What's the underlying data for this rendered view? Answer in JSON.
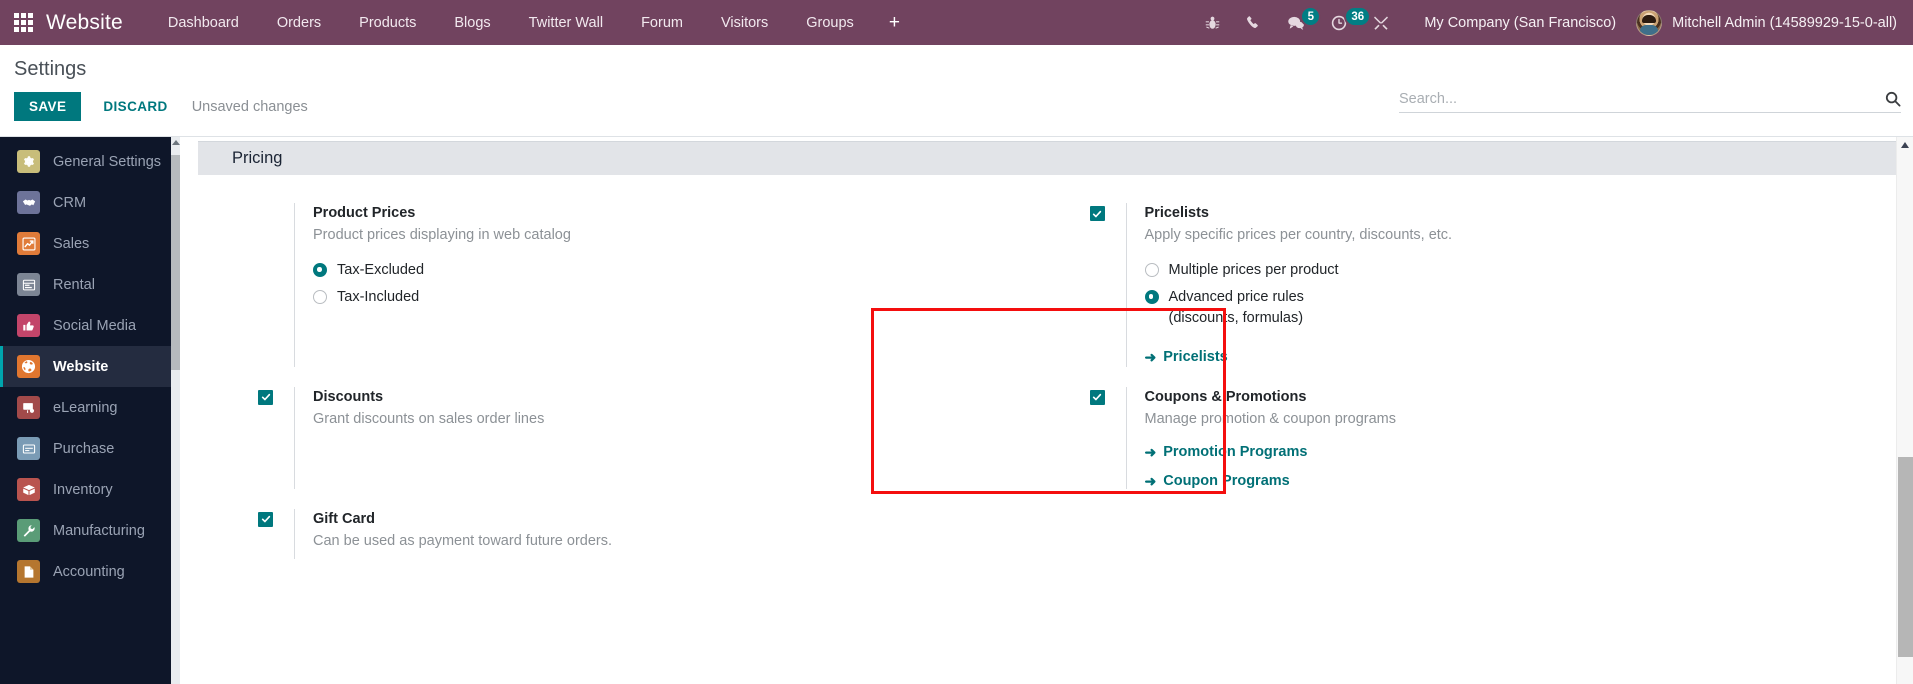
{
  "navbar": {
    "apps_icon": "apps-grid-icon",
    "brand": "Website",
    "menu_items": [
      {
        "label": "Dashboard"
      },
      {
        "label": "Orders"
      },
      {
        "label": "Products"
      },
      {
        "label": "Blogs"
      },
      {
        "label": "Twitter Wall"
      },
      {
        "label": "Forum"
      },
      {
        "label": "Visitors"
      },
      {
        "label": "Groups"
      }
    ],
    "add_label": "+",
    "systray": [
      {
        "name": "bug-icon",
        "badge": ""
      },
      {
        "name": "phone-icon",
        "badge": ""
      },
      {
        "name": "messages-icon",
        "badge": "5"
      },
      {
        "name": "activities-clock-icon",
        "badge": "36"
      },
      {
        "name": "tools-icon",
        "badge": ""
      }
    ],
    "company": "My Company (San Francisco)",
    "user": "Mitchell Admin (14589929-15-0-all)",
    "background_color": "#71435f"
  },
  "control_panel": {
    "title": "Settings",
    "save_label": "SAVE",
    "discard_label": "DISCARD",
    "status_text": "Unsaved changes",
    "accent_color": "#00787e"
  },
  "search": {
    "placeholder": "Search...",
    "value": "",
    "icon": "search-icon"
  },
  "sidebar": {
    "items": [
      {
        "label": "General Settings",
        "icon": "gear-icon",
        "color": "#c8bd7a",
        "active": false
      },
      {
        "label": "CRM",
        "icon": "handshake-icon",
        "color": "#6d7399",
        "active": false
      },
      {
        "label": "Sales",
        "icon": "chart-up-icon",
        "color": "#e07b39",
        "active": false
      },
      {
        "label": "Rental",
        "icon": "calendar-icon",
        "color": "#7c8594",
        "active": false
      },
      {
        "label": "Social Media",
        "icon": "thumbs-up-icon",
        "color": "#c3456a",
        "active": false
      },
      {
        "label": "Website",
        "icon": "globe-icon",
        "color": "#e0762f",
        "active": true
      },
      {
        "label": "eLearning",
        "icon": "presentation-icon",
        "color": "#a24a4a",
        "active": false
      },
      {
        "label": "Purchase",
        "icon": "card-icon",
        "color": "#7a9bb5",
        "active": false
      },
      {
        "label": "Inventory",
        "icon": "box-icon",
        "color": "#b9544f",
        "active": false
      },
      {
        "label": "Manufacturing",
        "icon": "wrench-icon",
        "color": "#5a9c77",
        "active": false
      },
      {
        "label": "Accounting",
        "icon": "document-icon",
        "color": "#b5762f",
        "active": false
      }
    ]
  },
  "settings": {
    "section_title": "Pricing",
    "blocks": [
      {
        "id": "product-prices",
        "control": "none",
        "label": "Product Prices",
        "help": "Product prices displaying in web catalog",
        "radios": [
          {
            "label": "Tax-Excluded",
            "selected": true
          },
          {
            "label": "Tax-Included",
            "selected": false
          }
        ],
        "links": []
      },
      {
        "id": "pricelists",
        "control": "checkbox",
        "checked": true,
        "label": "Pricelists",
        "help": "Apply specific prices per country, discounts, etc.",
        "radios": [
          {
            "label": "Multiple prices per product",
            "selected": false
          },
          {
            "label": "Advanced price rules (discounts, formulas)",
            "selected": true
          }
        ],
        "links": [
          {
            "label": "Pricelists"
          }
        ]
      },
      {
        "id": "discounts",
        "control": "checkbox",
        "checked": true,
        "label": "Discounts",
        "help": "Grant discounts on sales order lines",
        "radios": [],
        "links": []
      },
      {
        "id": "coupons-promotions",
        "control": "checkbox",
        "checked": true,
        "label": "Coupons & Promotions",
        "help": "Manage promotion & coupon programs",
        "radios": [],
        "links": [
          {
            "label": "Promotion Programs"
          },
          {
            "label": "Coupon Programs"
          }
        ]
      },
      {
        "id": "gift-card",
        "control": "checkbox",
        "checked": true,
        "label": "Gift Card",
        "help": "Can be used as payment toward future orders.",
        "radios": [],
        "links": []
      }
    ],
    "highlight_color": "#f40e0e"
  }
}
